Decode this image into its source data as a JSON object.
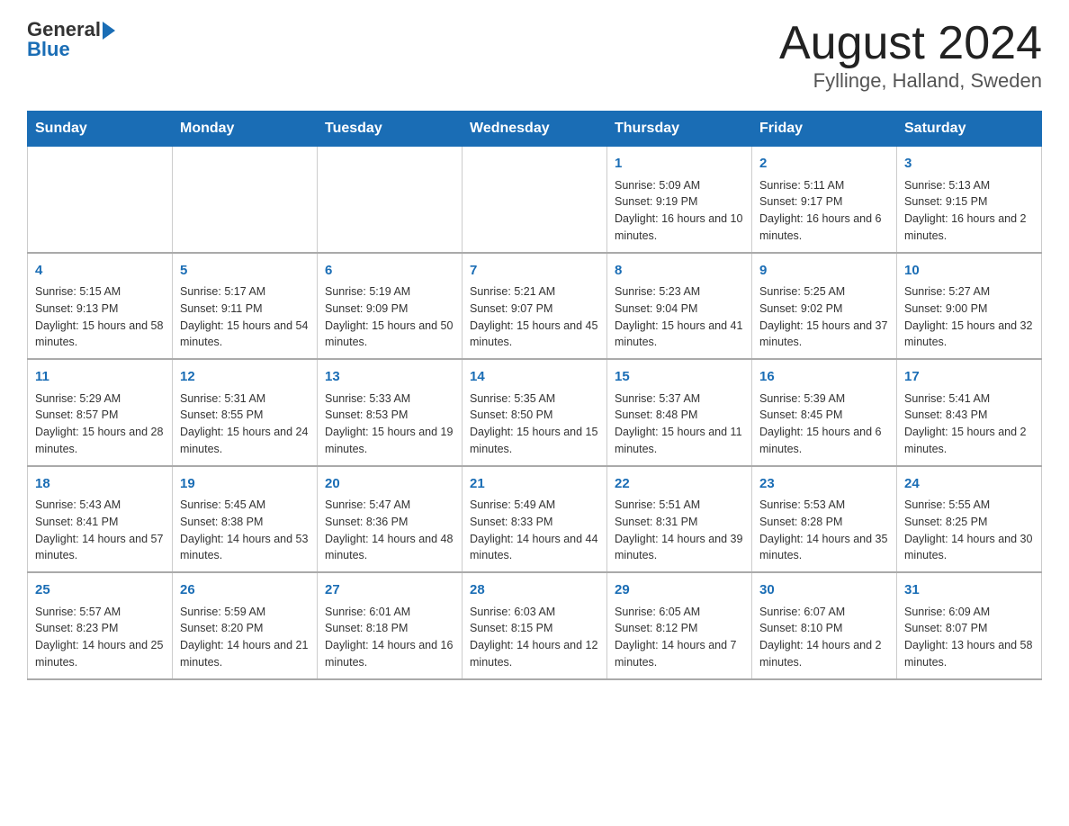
{
  "header": {
    "logo_general": "General",
    "logo_blue": "Blue",
    "month_title": "August 2024",
    "location": "Fyllinge, Halland, Sweden"
  },
  "weekdays": [
    "Sunday",
    "Monday",
    "Tuesday",
    "Wednesday",
    "Thursday",
    "Friday",
    "Saturday"
  ],
  "weeks": [
    [
      {
        "day": "",
        "info": ""
      },
      {
        "day": "",
        "info": ""
      },
      {
        "day": "",
        "info": ""
      },
      {
        "day": "",
        "info": ""
      },
      {
        "day": "1",
        "info": "Sunrise: 5:09 AM\nSunset: 9:19 PM\nDaylight: 16 hours and 10 minutes."
      },
      {
        "day": "2",
        "info": "Sunrise: 5:11 AM\nSunset: 9:17 PM\nDaylight: 16 hours and 6 minutes."
      },
      {
        "day": "3",
        "info": "Sunrise: 5:13 AM\nSunset: 9:15 PM\nDaylight: 16 hours and 2 minutes."
      }
    ],
    [
      {
        "day": "4",
        "info": "Sunrise: 5:15 AM\nSunset: 9:13 PM\nDaylight: 15 hours and 58 minutes."
      },
      {
        "day": "5",
        "info": "Sunrise: 5:17 AM\nSunset: 9:11 PM\nDaylight: 15 hours and 54 minutes."
      },
      {
        "day": "6",
        "info": "Sunrise: 5:19 AM\nSunset: 9:09 PM\nDaylight: 15 hours and 50 minutes."
      },
      {
        "day": "7",
        "info": "Sunrise: 5:21 AM\nSunset: 9:07 PM\nDaylight: 15 hours and 45 minutes."
      },
      {
        "day": "8",
        "info": "Sunrise: 5:23 AM\nSunset: 9:04 PM\nDaylight: 15 hours and 41 minutes."
      },
      {
        "day": "9",
        "info": "Sunrise: 5:25 AM\nSunset: 9:02 PM\nDaylight: 15 hours and 37 minutes."
      },
      {
        "day": "10",
        "info": "Sunrise: 5:27 AM\nSunset: 9:00 PM\nDaylight: 15 hours and 32 minutes."
      }
    ],
    [
      {
        "day": "11",
        "info": "Sunrise: 5:29 AM\nSunset: 8:57 PM\nDaylight: 15 hours and 28 minutes."
      },
      {
        "day": "12",
        "info": "Sunrise: 5:31 AM\nSunset: 8:55 PM\nDaylight: 15 hours and 24 minutes."
      },
      {
        "day": "13",
        "info": "Sunrise: 5:33 AM\nSunset: 8:53 PM\nDaylight: 15 hours and 19 minutes."
      },
      {
        "day": "14",
        "info": "Sunrise: 5:35 AM\nSunset: 8:50 PM\nDaylight: 15 hours and 15 minutes."
      },
      {
        "day": "15",
        "info": "Sunrise: 5:37 AM\nSunset: 8:48 PM\nDaylight: 15 hours and 11 minutes."
      },
      {
        "day": "16",
        "info": "Sunrise: 5:39 AM\nSunset: 8:45 PM\nDaylight: 15 hours and 6 minutes."
      },
      {
        "day": "17",
        "info": "Sunrise: 5:41 AM\nSunset: 8:43 PM\nDaylight: 15 hours and 2 minutes."
      }
    ],
    [
      {
        "day": "18",
        "info": "Sunrise: 5:43 AM\nSunset: 8:41 PM\nDaylight: 14 hours and 57 minutes."
      },
      {
        "day": "19",
        "info": "Sunrise: 5:45 AM\nSunset: 8:38 PM\nDaylight: 14 hours and 53 minutes."
      },
      {
        "day": "20",
        "info": "Sunrise: 5:47 AM\nSunset: 8:36 PM\nDaylight: 14 hours and 48 minutes."
      },
      {
        "day": "21",
        "info": "Sunrise: 5:49 AM\nSunset: 8:33 PM\nDaylight: 14 hours and 44 minutes."
      },
      {
        "day": "22",
        "info": "Sunrise: 5:51 AM\nSunset: 8:31 PM\nDaylight: 14 hours and 39 minutes."
      },
      {
        "day": "23",
        "info": "Sunrise: 5:53 AM\nSunset: 8:28 PM\nDaylight: 14 hours and 35 minutes."
      },
      {
        "day": "24",
        "info": "Sunrise: 5:55 AM\nSunset: 8:25 PM\nDaylight: 14 hours and 30 minutes."
      }
    ],
    [
      {
        "day": "25",
        "info": "Sunrise: 5:57 AM\nSunset: 8:23 PM\nDaylight: 14 hours and 25 minutes."
      },
      {
        "day": "26",
        "info": "Sunrise: 5:59 AM\nSunset: 8:20 PM\nDaylight: 14 hours and 21 minutes."
      },
      {
        "day": "27",
        "info": "Sunrise: 6:01 AM\nSunset: 8:18 PM\nDaylight: 14 hours and 16 minutes."
      },
      {
        "day": "28",
        "info": "Sunrise: 6:03 AM\nSunset: 8:15 PM\nDaylight: 14 hours and 12 minutes."
      },
      {
        "day": "29",
        "info": "Sunrise: 6:05 AM\nSunset: 8:12 PM\nDaylight: 14 hours and 7 minutes."
      },
      {
        "day": "30",
        "info": "Sunrise: 6:07 AM\nSunset: 8:10 PM\nDaylight: 14 hours and 2 minutes."
      },
      {
        "day": "31",
        "info": "Sunrise: 6:09 AM\nSunset: 8:07 PM\nDaylight: 13 hours and 58 minutes."
      }
    ]
  ]
}
